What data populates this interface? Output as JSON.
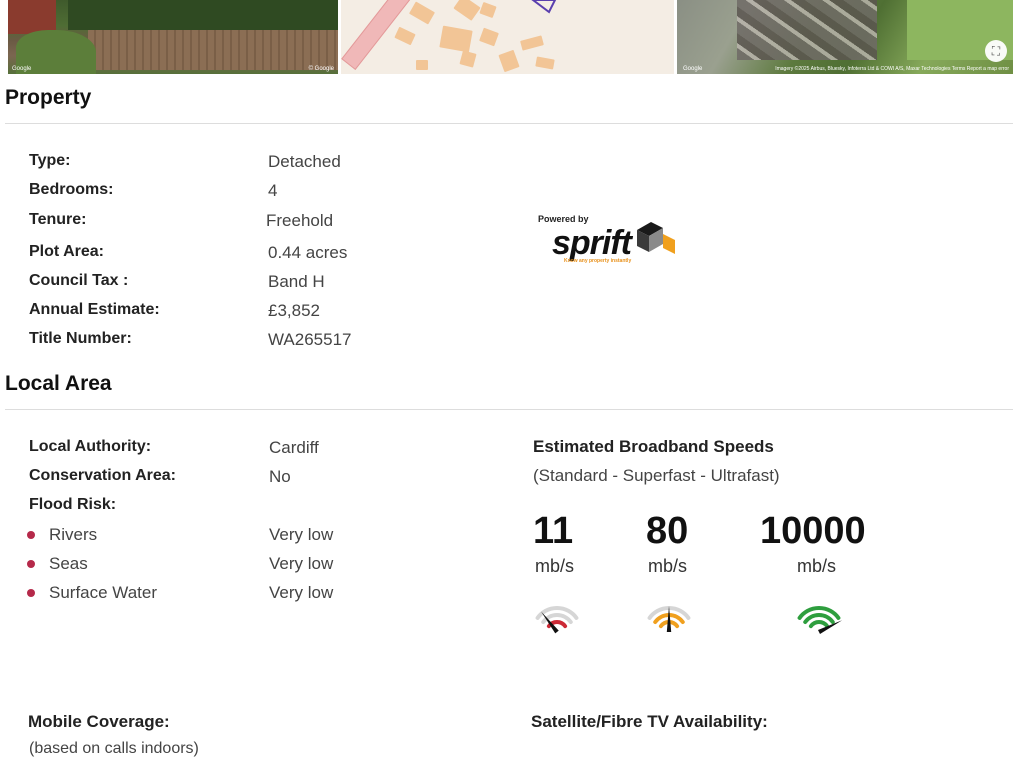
{
  "images": {
    "street_view": {
      "credit_left": "Google",
      "credit_right": "© Google"
    },
    "map": {},
    "satellite": {
      "credit_left": "Google",
      "credit_right": "Imagery ©2025 Airbus, Bluesky, Infoterra Ltd & COWI A/S, Maxar Technologies  Terms  Report a map error"
    }
  },
  "property": {
    "title": "Property",
    "rows": [
      {
        "label": "Type:",
        "value": "Detached"
      },
      {
        "label": "Bedrooms:",
        "value": "4"
      },
      {
        "label": "Tenure:",
        "value": "Freehold"
      },
      {
        "label": "Plot Area:",
        "value": "0.44 acres"
      },
      {
        "label": "Council Tax :",
        "value": "Band H"
      },
      {
        "label": "Annual Estimate:",
        "value": "£3,852"
      },
      {
        "label": "Title Number:",
        "value": "WA265517"
      }
    ],
    "logo": {
      "powered_by": "Powered by",
      "brand": "sprift",
      "tagline": "Know any property instantly"
    }
  },
  "local_area": {
    "title": "Local Area",
    "local_authority": {
      "label": "Local Authority:",
      "value": "Cardiff"
    },
    "conservation_area": {
      "label": "Conservation Area:",
      "value": "No"
    },
    "flood_risk": {
      "label": "Flood Risk:",
      "items": [
        {
          "label": "Rivers",
          "value": "Very low"
        },
        {
          "label": "Seas",
          "value": "Very low"
        },
        {
          "label": "Surface Water",
          "value": "Very low"
        }
      ]
    },
    "broadband": {
      "title": "Estimated Broadband Speeds",
      "subtitle": "(Standard - Superfast - Ultrafast)",
      "speeds": [
        {
          "value": "11",
          "unit": "mb/s",
          "level": 0.2,
          "color": "#cc2a36"
        },
        {
          "value": "80",
          "unit": "mb/s",
          "level": 0.5,
          "color": "#f0a01e"
        },
        {
          "value": "10000",
          "unit": "mb/s",
          "level": 1.0,
          "color": "#2e9e3e"
        }
      ]
    },
    "mobile": {
      "label": "Mobile Coverage:",
      "sub": "(based on calls indoors)"
    },
    "tv": {
      "label": "Satellite/Fibre TV Availability:"
    }
  }
}
